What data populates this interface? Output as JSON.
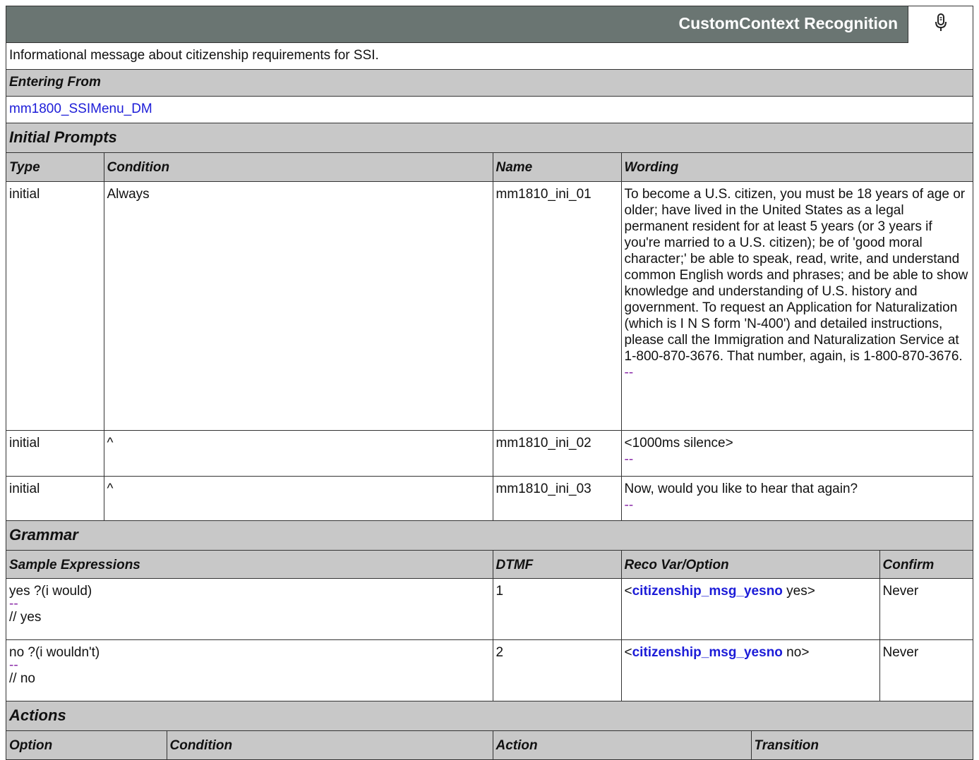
{
  "header": {
    "title": "CustomContext Recognition",
    "icon": "microphone-icon"
  },
  "description": "Informational message about citizenship requirements for SSI.",
  "entering_from": {
    "heading": "Entering From",
    "link": "mm1800_SSIMenu_DM"
  },
  "initial_prompts": {
    "heading": "Initial Prompts",
    "columns": [
      "Type",
      "Condition",
      "Name",
      "Wording"
    ],
    "rows": [
      {
        "type": "initial",
        "condition": "Always",
        "name": "mm1810_ini_01",
        "wording": "To become a U.S. citizen, you must be 18 years of age or older; have lived in the United States as a legal permanent resident for at least 5 years (or 3 years if you're married to a U.S. citizen); be of 'good moral character;' be able to speak, read, write, and understand common English words and phrases; and be able to show knowledge and understanding of U.S. history and government. To request an Application for Naturalization (which is I N S form 'N-400') and detailed instructions, please call the Immigration and Naturalization Service at 1-800-870-3676. That number, again, is 1-800-870-3676.",
        "dash": "--"
      },
      {
        "type": "initial",
        "condition": "^",
        "name": "mm1810_ini_02",
        "wording": "<1000ms silence>",
        "dash": "--"
      },
      {
        "type": "initial",
        "condition": "^",
        "name": "mm1810_ini_03",
        "wording": "Now, would you like to hear that again?",
        "dash": "--"
      }
    ]
  },
  "grammar": {
    "heading": "Grammar",
    "columns": [
      "Sample Expressions",
      "DTMF",
      "Reco Var/Option",
      "Confirm"
    ],
    "rows": [
      {
        "expression": "yes ?(i would)",
        "dash": "--",
        "comment": "// yes",
        "dtmf": "1",
        "reco_open": "<",
        "reco_var": "citizenship_msg_yesno",
        "reco_value": " yes>",
        "confirm": "Never"
      },
      {
        "expression": "no ?(i wouldn't)",
        "dash": "--",
        "comment": "// no",
        "dtmf": "2",
        "reco_open": "<",
        "reco_var": "citizenship_msg_yesno",
        "reco_value": " no>",
        "confirm": "Never"
      }
    ]
  },
  "actions": {
    "heading": "Actions",
    "columns": [
      "Option",
      "Condition",
      "Action",
      "Transition"
    ]
  }
}
